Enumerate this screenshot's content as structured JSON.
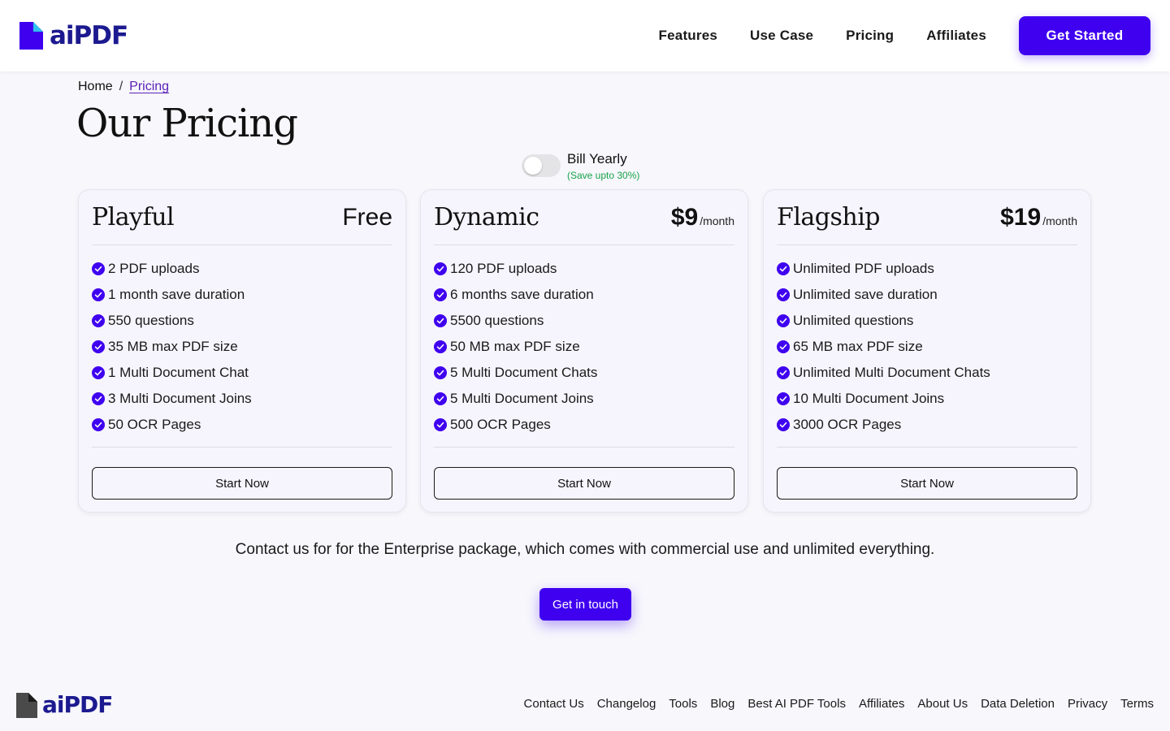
{
  "brand": {
    "name": "aiPDF",
    "accent_color": "#3f00f0",
    "logo_dark_color": "#1c1a8f"
  },
  "header": {
    "nav": [
      "Features",
      "Use Case",
      "Pricing",
      "Affiliates"
    ],
    "cta_label": "Get Started"
  },
  "breadcrumb": {
    "home": "Home",
    "separator": "/",
    "current": "Pricing"
  },
  "page_title": "Our Pricing",
  "billing": {
    "label": "Bill Yearly",
    "save_note": "(Save upto 30%)",
    "yearly_enabled": false
  },
  "plans": [
    {
      "name": "Playful",
      "price": "Free",
      "unit": "",
      "features": [
        "2 PDF uploads",
        "1 month save duration",
        "550 questions",
        "35 MB max PDF size",
        "1 Multi Document Chat",
        "3 Multi Document Joins",
        "50 OCR Pages"
      ],
      "button": "Start Now"
    },
    {
      "name": "Dynamic",
      "price": "$9",
      "unit": "/month",
      "features": [
        "120 PDF uploads",
        "6 months save duration",
        "5500 questions",
        "50 MB max PDF size",
        "5 Multi Document Chats",
        "5 Multi Document Joins",
        "500 OCR Pages"
      ],
      "button": "Start Now"
    },
    {
      "name": "Flagship",
      "price": "$19",
      "unit": "/month",
      "features": [
        "Unlimited PDF uploads",
        "Unlimited save duration",
        "Unlimited questions",
        "65 MB max PDF size",
        "Unlimited Multi Document Chats",
        "10 Multi Document Joins",
        "3000 OCR Pages"
      ],
      "button": "Start Now"
    }
  ],
  "enterprise": {
    "text": "Contact us for for the Enterprise package, which comes with commercial use and unlimited everything.",
    "button": "Get in touch"
  },
  "footer": {
    "links": [
      "Contact Us",
      "Changelog",
      "Tools",
      "Blog",
      "Best AI PDF Tools",
      "Affiliates",
      "About Us",
      "Data Deletion",
      "Privacy",
      "Terms"
    ]
  }
}
